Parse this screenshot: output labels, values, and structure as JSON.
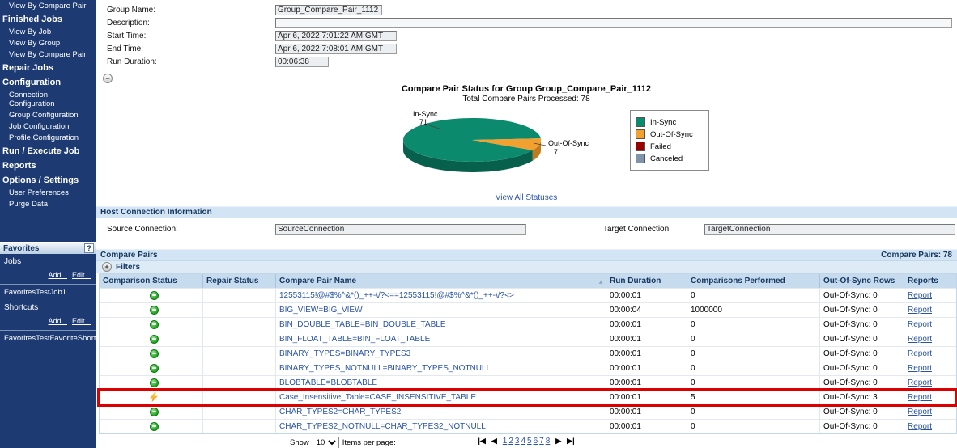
{
  "sidebar": {
    "menu": [
      {
        "label": "View By Compare Pair",
        "type": "link"
      },
      {
        "label": "Finished Jobs",
        "type": "header"
      },
      {
        "label": "View By Job",
        "type": "link"
      },
      {
        "label": "View By Group",
        "type": "link"
      },
      {
        "label": "View By Compare Pair",
        "type": "link"
      },
      {
        "label": "Repair Jobs",
        "type": "header"
      },
      {
        "label": "Configuration",
        "type": "header"
      },
      {
        "label": "Connection Configuration",
        "type": "link"
      },
      {
        "label": "Group Configuration",
        "type": "link"
      },
      {
        "label": "Job Configuration",
        "type": "link"
      },
      {
        "label": "Profile Configuration",
        "type": "link"
      },
      {
        "label": "Run / Execute Job",
        "type": "header"
      },
      {
        "label": "Reports",
        "type": "header"
      },
      {
        "label": "Options / Settings",
        "type": "header"
      },
      {
        "label": "User Preferences",
        "type": "link"
      },
      {
        "label": "Purge Data",
        "type": "link"
      }
    ],
    "favorites": {
      "title": "Favorites",
      "help": "?",
      "sections": [
        {
          "label": "Jobs",
          "add_label": "Add...",
          "edit_label": "Edit...",
          "items": [
            "FavoritesTestJob1"
          ]
        },
        {
          "label": "Shortcuts",
          "add_label": "Add...",
          "edit_label": "Edit...",
          "items": [
            "FavoritesTestFavoriteShortcut"
          ]
        }
      ]
    }
  },
  "form": {
    "fields": [
      {
        "label": "Group Name:",
        "value": "Group_Compare_Pair_1112"
      },
      {
        "label": "Description:",
        "value": ""
      },
      {
        "label": "Start Time:",
        "value": "Apr 6, 2022 7:01:22 AM GMT"
      },
      {
        "label": "End Time:",
        "value": "Apr 6, 2022 7:08:01 AM GMT"
      },
      {
        "label": "Run Duration:",
        "value": "00:06:38"
      }
    ]
  },
  "chart_data": {
    "type": "pie",
    "title": "Compare Pair Status for Group Group_Compare_Pair_1112",
    "subtitle": "Total Compare Pairs Processed: 78",
    "total": 78,
    "slices": [
      {
        "label": "In-Sync",
        "value": 71,
        "color": "#0b8a6d"
      },
      {
        "label": "Out-Of-Sync",
        "value": 7,
        "color": "#f2a030"
      }
    ],
    "legend": [
      {
        "label": "In-Sync",
        "color": "#0b8a6d"
      },
      {
        "label": "Out-Of-Sync",
        "color": "#f2a030"
      },
      {
        "label": "Failed",
        "color": "#990000"
      },
      {
        "label": "Canceled",
        "color": "#7f94ab"
      }
    ],
    "link": "View All Statuses",
    "legend_position": "right"
  },
  "host_connection": {
    "title": "Host Connection Information",
    "source_label": "Source Connection:",
    "source_value": "SourceConnection",
    "target_label": "Target Connection:",
    "target_value": "TargetConnection"
  },
  "compare_pairs": {
    "title": "Compare Pairs",
    "count_label": "Compare Pairs: 78",
    "filters_label": "Filters",
    "sort_column": 2,
    "sort_indicator": "▲",
    "columns": [
      "Comparison Status",
      "Repair Status",
      "Compare Pair Name",
      "Run Duration",
      "Comparisons Performed",
      "Out-Of-Sync Rows",
      "Reports"
    ],
    "rows": [
      {
        "status": "in-sync",
        "repair": "",
        "name": "12553115!@#$%^&*()_++-\\/?<==12553115!@#$%^&*()_++-\\/?<>",
        "duration": "00:00:01",
        "comparisons": "0",
        "out_of_sync": "Out-Of-Sync: 0",
        "report": "Report",
        "highlight": false
      },
      {
        "status": "in-sync",
        "repair": "",
        "name": "BIG_VIEW=BIG_VIEW",
        "duration": "00:00:04",
        "comparisons": "1000000",
        "out_of_sync": "Out-Of-Sync: 0",
        "report": "Report",
        "highlight": false
      },
      {
        "status": "in-sync",
        "repair": "",
        "name": "BIN_DOUBLE_TABLE=BIN_DOUBLE_TABLE",
        "duration": "00:00:01",
        "comparisons": "0",
        "out_of_sync": "Out-Of-Sync: 0",
        "report": "Report",
        "highlight": false
      },
      {
        "status": "in-sync",
        "repair": "",
        "name": "BIN_FLOAT_TABLE=BIN_FLOAT_TABLE",
        "duration": "00:00:01",
        "comparisons": "0",
        "out_of_sync": "Out-Of-Sync: 0",
        "report": "Report",
        "highlight": false
      },
      {
        "status": "in-sync",
        "repair": "",
        "name": "BINARY_TYPES=BINARY_TYPES3",
        "duration": "00:00:01",
        "comparisons": "0",
        "out_of_sync": "Out-Of-Sync: 0",
        "report": "Report",
        "highlight": false
      },
      {
        "status": "in-sync",
        "repair": "",
        "name": "BINARY_TYPES_NOTNULL=BINARY_TYPES_NOTNULL",
        "duration": "00:00:01",
        "comparisons": "0",
        "out_of_sync": "Out-Of-Sync: 0",
        "report": "Report",
        "highlight": false
      },
      {
        "status": "in-sync",
        "repair": "",
        "name": "BLOBTABLE=BLOBTABLE",
        "duration": "00:00:01",
        "comparisons": "0",
        "out_of_sync": "Out-Of-Sync: 0",
        "report": "Report",
        "highlight": false
      },
      {
        "status": "out-of-sync",
        "repair": "",
        "name": "Case_Insensitive_Table=CASE_INSENSITIVE_TABLE",
        "duration": "00:00:01",
        "comparisons": "5",
        "out_of_sync": "Out-Of-Sync: 3",
        "report": "Report",
        "highlight": true
      },
      {
        "status": "in-sync",
        "repair": "",
        "name": "CHAR_TYPES2=CHAR_TYPES2",
        "duration": "00:00:01",
        "comparisons": "0",
        "out_of_sync": "Out-Of-Sync: 0",
        "report": "Report",
        "highlight": false
      },
      {
        "status": "in-sync",
        "repair": "",
        "name": "CHAR_TYPES2_NOTNULL=CHAR_TYPES2_NOTNULL",
        "duration": "00:00:01",
        "comparisons": "0",
        "out_of_sync": "Out-Of-Sync: 0",
        "report": "Report",
        "highlight": false
      }
    ],
    "pagination": {
      "show_label": "Show",
      "page_size": "10",
      "items_label": "Items per page:",
      "first_icon": "|◀",
      "prev_icon": "◀",
      "pages": [
        "1",
        "2",
        "3",
        "4",
        "5",
        "6",
        "7",
        "8"
      ],
      "next_icon": "▶",
      "last_icon": "▶|"
    }
  }
}
